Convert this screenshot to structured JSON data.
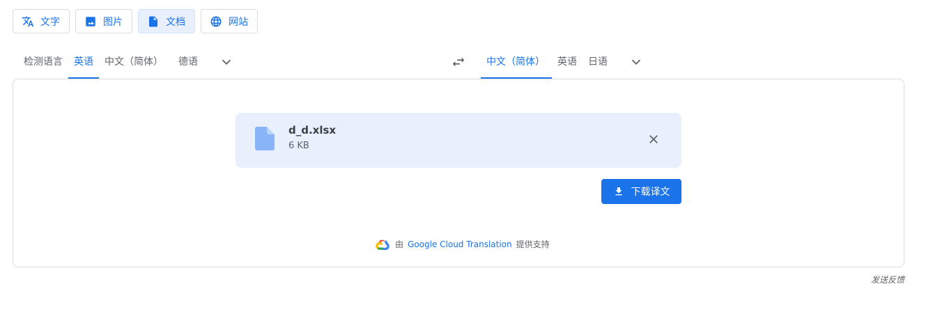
{
  "modes": [
    {
      "label": "文字",
      "icon": "translate-icon",
      "active": false
    },
    {
      "label": "图片",
      "icon": "image-icon",
      "active": false
    },
    {
      "label": "文档",
      "icon": "document-icon",
      "active": true
    },
    {
      "label": "网站",
      "icon": "globe-icon",
      "active": false
    }
  ],
  "source_languages": [
    {
      "label": "检测语言",
      "active": false
    },
    {
      "label": "英语",
      "active": true
    },
    {
      "label": "中文（简体）",
      "active": false
    },
    {
      "label": "德语",
      "active": false
    }
  ],
  "target_languages": [
    {
      "label": "中文（简体）",
      "active": true
    },
    {
      "label": "英语",
      "active": false
    },
    {
      "label": "日语",
      "active": false
    }
  ],
  "file": {
    "name": "d_d.xlsx",
    "size": "6 KB"
  },
  "download_label": "下载译文",
  "powered_by": {
    "prefix": "由",
    "link": "Google Cloud Translation",
    "suffix": "提供支持"
  },
  "feedback_label": "发送反馈",
  "colors": {
    "accent": "#1a73e8",
    "card_bg": "#e8f0fe",
    "file_icon": "#8ab4f8"
  }
}
